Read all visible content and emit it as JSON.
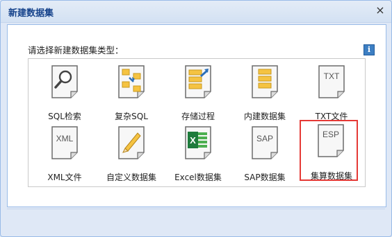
{
  "dialog": {
    "title": "新建数据集",
    "close_glyph": "×",
    "prompt": "请选择新建数据集类型：",
    "info_glyph": "i",
    "accent_color": "#15428b",
    "selected_border_color": "#e53935"
  },
  "types": [
    {
      "label": "SQL检索",
      "icon": "search-icon",
      "selected": false
    },
    {
      "label": "复杂SQL",
      "icon": "complex-sql-icon",
      "selected": false
    },
    {
      "label": "存储过程",
      "icon": "stored-procedure-icon",
      "selected": false
    },
    {
      "label": "内建数据集",
      "icon": "builtin-dataset-icon",
      "selected": false
    },
    {
      "label": "TXT文件",
      "icon": "txt-file-icon",
      "icon_text": "TXT",
      "selected": false
    },
    {
      "label": "XML文件",
      "icon": "xml-file-icon",
      "icon_text": "XML",
      "selected": false
    },
    {
      "label": "自定义数据集",
      "icon": "pencil-icon",
      "selected": false
    },
    {
      "label": "Excel数据集",
      "icon": "excel-icon",
      "selected": false
    },
    {
      "label": "SAP数据集",
      "icon": "sap-icon",
      "icon_text": "SAP",
      "selected": false
    },
    {
      "label": "集算数据集",
      "icon": "esp-icon",
      "icon_text": "ESP",
      "selected": true
    }
  ]
}
